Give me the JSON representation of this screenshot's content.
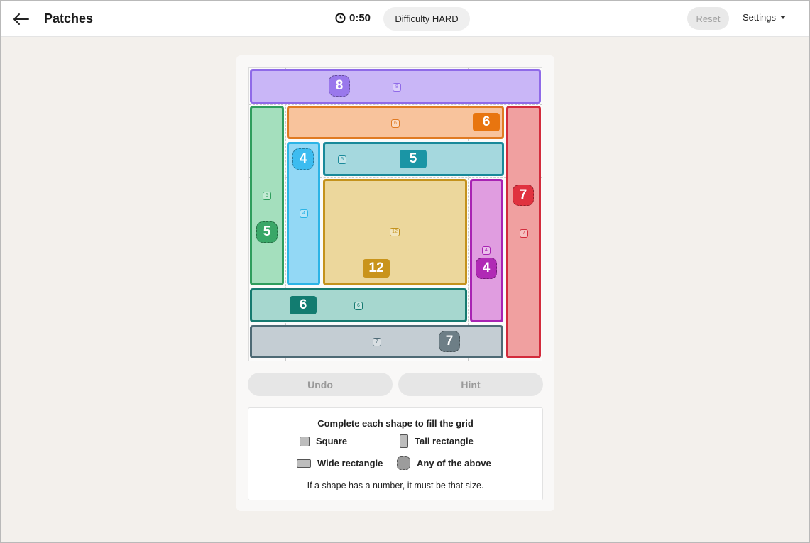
{
  "header": {
    "title": "Patches",
    "timer": "0:50",
    "difficulty": "Difficulty HARD",
    "reset_label": "Reset",
    "settings_label": "Settings"
  },
  "board": {
    "patches": [
      {
        "name": "purple",
        "size": "8",
        "fill": "#c9b6f7",
        "border": "#8f6ae8"
      },
      {
        "name": "orange",
        "size": "6",
        "fill": "#f8c39c",
        "border": "#e07a22"
      },
      {
        "name": "green",
        "size": "5",
        "fill": "#a4dfbd",
        "border": "#2f9d5d"
      },
      {
        "name": "red",
        "size": "7",
        "fill": "#f0a0a0",
        "border": "#d32b3c"
      },
      {
        "name": "lightblue",
        "size": "4",
        "fill": "#93d8f5",
        "border": "#2cb4e6"
      },
      {
        "name": "teal",
        "size": "5",
        "fill": "#a5d8de",
        "border": "#19899a"
      },
      {
        "name": "gold",
        "size": "12",
        "fill": "#ecd79c",
        "border": "#c4921c"
      },
      {
        "name": "magenta",
        "size": "4",
        "fill": "#e09de0",
        "border": "#a823b3"
      },
      {
        "name": "darkteal",
        "size": "6",
        "fill": "#a6d7cf",
        "border": "#167a70"
      },
      {
        "name": "gray",
        "size": "7",
        "fill": "#c4cdd3",
        "border": "#4e6a75"
      }
    ],
    "clues": [
      {
        "label": "8",
        "kind": "any",
        "color": "#9a78ec"
      },
      {
        "label": "6",
        "kind": "solid",
        "color": "#e8750f"
      },
      {
        "label": "4",
        "kind": "any",
        "color": "#3cbcf0"
      },
      {
        "label": "5",
        "kind": "solid",
        "color": "#1a95a5"
      },
      {
        "label": "7",
        "kind": "any",
        "color": "#e0323f"
      },
      {
        "label": "5",
        "kind": "any",
        "color": "#3aa768"
      },
      {
        "label": "12",
        "kind": "solid",
        "color": "#c9941b"
      },
      {
        "label": "4",
        "kind": "any",
        "color": "#b02ab5"
      },
      {
        "label": "6",
        "kind": "solid",
        "color": "#127c70"
      },
      {
        "label": "7",
        "kind": "any",
        "color": "#6d7e86"
      }
    ]
  },
  "controls": {
    "undo_label": "Undo",
    "hint_label": "Hint"
  },
  "legend": {
    "title": "Complete each shape to fill the grid",
    "square": "Square",
    "tall": "Tall rectangle",
    "wide": "Wide rectangle",
    "any": "Any of the above",
    "note": "If a shape has a number, it must be that size."
  }
}
